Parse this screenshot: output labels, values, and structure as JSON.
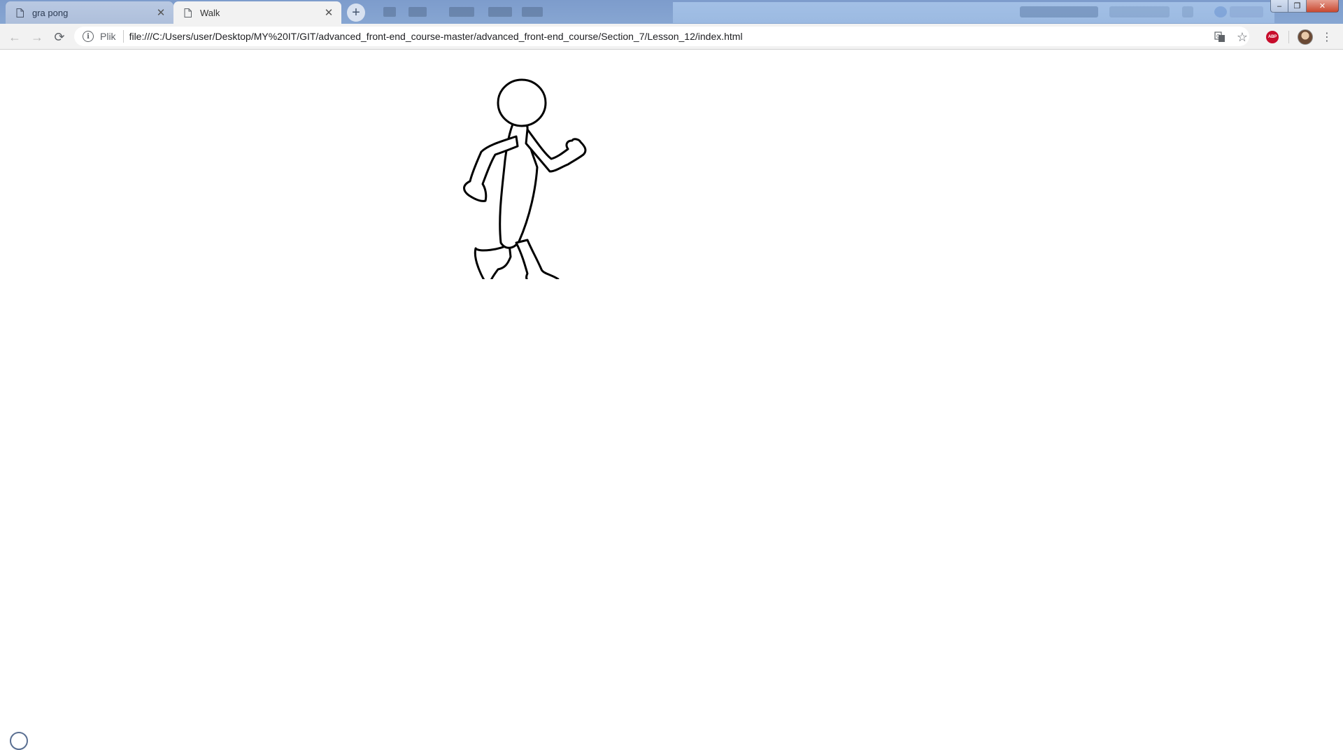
{
  "browser": {
    "tabs": [
      {
        "title": "gra pong",
        "active": false,
        "icon": "page-icon"
      },
      {
        "title": "Walk",
        "active": true,
        "icon": "page-icon"
      }
    ],
    "new_tab_icon": "plus-icon",
    "window_controls": {
      "minimize": "–",
      "maximize": "❐",
      "close": "✕"
    }
  },
  "toolbar": {
    "back_icon": "←",
    "forward_icon": "→",
    "reload_icon": "⟳",
    "security_chip": "Plik",
    "url": "file:///C:/Users/user/Desktop/MY%20IT/GIT/advanced_front-end_course-master/advanced_front-end_course/Section_7/Lesson_12/index.html",
    "translate_icon": "translate-icon",
    "bookmark_icon": "☆",
    "extension_badge": "ABP",
    "menu_icon": "⋮"
  },
  "page": {
    "content": "walking-stick-figure-sprite"
  },
  "colors": {
    "titlebar": "#7d9ccc",
    "active_tab": "#f2f2f2",
    "toolbar": "#f2f2f2",
    "abp_red": "#c70d2c",
    "page_background": "#ffffff"
  }
}
